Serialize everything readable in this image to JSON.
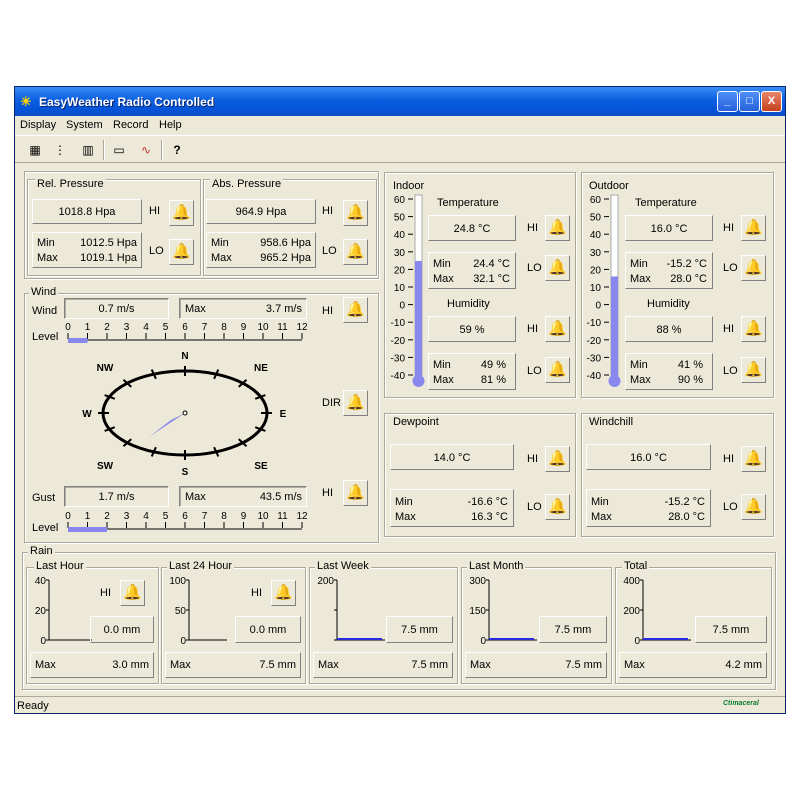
{
  "window": {
    "title": "EasyWeather Radio Controlled",
    "min": "_",
    "max": "□",
    "close": "X"
  },
  "menu": [
    "Display",
    "System",
    "Record",
    "Help"
  ],
  "toolbar": {
    "help": "?"
  },
  "pressure": {
    "rel": {
      "label": "Rel. Pressure",
      "value": "1018.8 Hpa",
      "min_label": "Min",
      "min": "1012.5 Hpa",
      "max_label": "Max",
      "max": "1019.1 Hpa",
      "hi": "HI",
      "lo": "LO"
    },
    "abs": {
      "label": "Abs. Pressure",
      "value": "964.9 Hpa",
      "min_label": "Min",
      "min": "958.6 Hpa",
      "max_label": "Max",
      "max": "965.2 Hpa",
      "hi": "HI",
      "lo": "LO"
    }
  },
  "wind": {
    "label": "Wind",
    "wind_label": "Wind",
    "wind": "0.7 m/s",
    "wind_max_label": "Max",
    "wind_max": "3.7 m/s",
    "hi": "HI",
    "level_label": "Level",
    "scale": [
      "0",
      "1",
      "2",
      "3",
      "4",
      "5",
      "6",
      "7",
      "8",
      "9",
      "10",
      "11",
      "12"
    ],
    "wind_level": 1,
    "dir": "DIR",
    "compass": {
      "N": "N",
      "NE": "NE",
      "E": "E",
      "SE": "SE",
      "S": "S",
      "SW": "SW",
      "W": "W",
      "NW": "NW"
    },
    "gust_label": "Gust",
    "gust": "1.7 m/s",
    "gust_max_label": "Max",
    "gust_max": "43.5 m/s",
    "gust_hi": "HI",
    "gust_level_label": "Level",
    "gust_level": 2
  },
  "indoor": {
    "label": "Indoor",
    "temp_label": "Temperature",
    "temp": "24.8 °C",
    "temp_min_label": "Min",
    "temp_min": "24.4 °C",
    "temp_max_label": "Max",
    "temp_max": "32.1 °C",
    "hum_label": "Humidity",
    "hum": "59 %",
    "hum_min_label": "Min",
    "hum_min": "49 %",
    "hum_max_label": "Max",
    "hum_max": "81 %",
    "hi": "HI",
    "lo": "LO",
    "hum_hi": "HI",
    "hum_lo": "LO",
    "temp_value": 24.8
  },
  "outdoor": {
    "label": "Outdoor",
    "temp_label": "Temperature",
    "temp": "16.0 °C",
    "temp_min_label": "Min",
    "temp_min": "-15.2 °C",
    "temp_max_label": "Max",
    "temp_max": "28.0 °C",
    "hum_label": "Humidity",
    "hum": "88 %",
    "hum_min_label": "Min",
    "hum_min": "41 %",
    "hum_max_label": "Max",
    "hum_max": "90 %",
    "hi": "HI",
    "lo": "LO",
    "hum_hi": "HI",
    "hum_lo": "LO",
    "temp_value": 16.0
  },
  "thermo_scale": [
    "60",
    "50",
    "40",
    "30",
    "20",
    "10",
    "0",
    "-10",
    "-20",
    "-30",
    "-40"
  ],
  "dewpoint": {
    "label": "Dewpoint",
    "value": "14.0 °C",
    "min_label": "Min",
    "min": "-16.6 °C",
    "max_label": "Max",
    "max": "16.3 °C",
    "hi": "HI",
    "lo": "LO"
  },
  "windchill": {
    "label": "Windchill",
    "value": "16.0 °C",
    "min_label": "Min",
    "min": "-15.2 °C",
    "max_label": "Max",
    "max": "28.0 °C",
    "hi": "HI",
    "lo": "LO"
  },
  "rain": {
    "label": "Rain",
    "hour": {
      "label": "Last Hour",
      "axis": [
        "40",
        "20",
        "0"
      ],
      "hi": "HI",
      "value": "0.0 mm",
      "max_label": "Max",
      "max": "3.0 mm"
    },
    "day": {
      "label": "Last 24 Hour",
      "axis": [
        "100",
        "50",
        "0"
      ],
      "hi": "HI",
      "value": "0.0 mm",
      "max_label": "Max",
      "max": "7.5 mm"
    },
    "week": {
      "label": "Last Week",
      "axis": [
        "200",
        "",
        ""
      ],
      "value": "7.5 mm",
      "max_label": "Max",
      "max": "7.5 mm"
    },
    "month": {
      "label": "Last Month",
      "axis": [
        "300",
        "150",
        "0"
      ],
      "value": "7.5 mm",
      "max_label": "Max",
      "max": "7.5 mm"
    },
    "total": {
      "label": "Total",
      "axis": [
        "400",
        "200",
        "0"
      ],
      "value": "7.5 mm",
      "max_label": "Max",
      "max": "4.2 mm"
    }
  },
  "status": "Ready",
  "brand": "Ctimaceral",
  "colors": {
    "accent": "#8888ee",
    "title": "#0a5fe0"
  }
}
